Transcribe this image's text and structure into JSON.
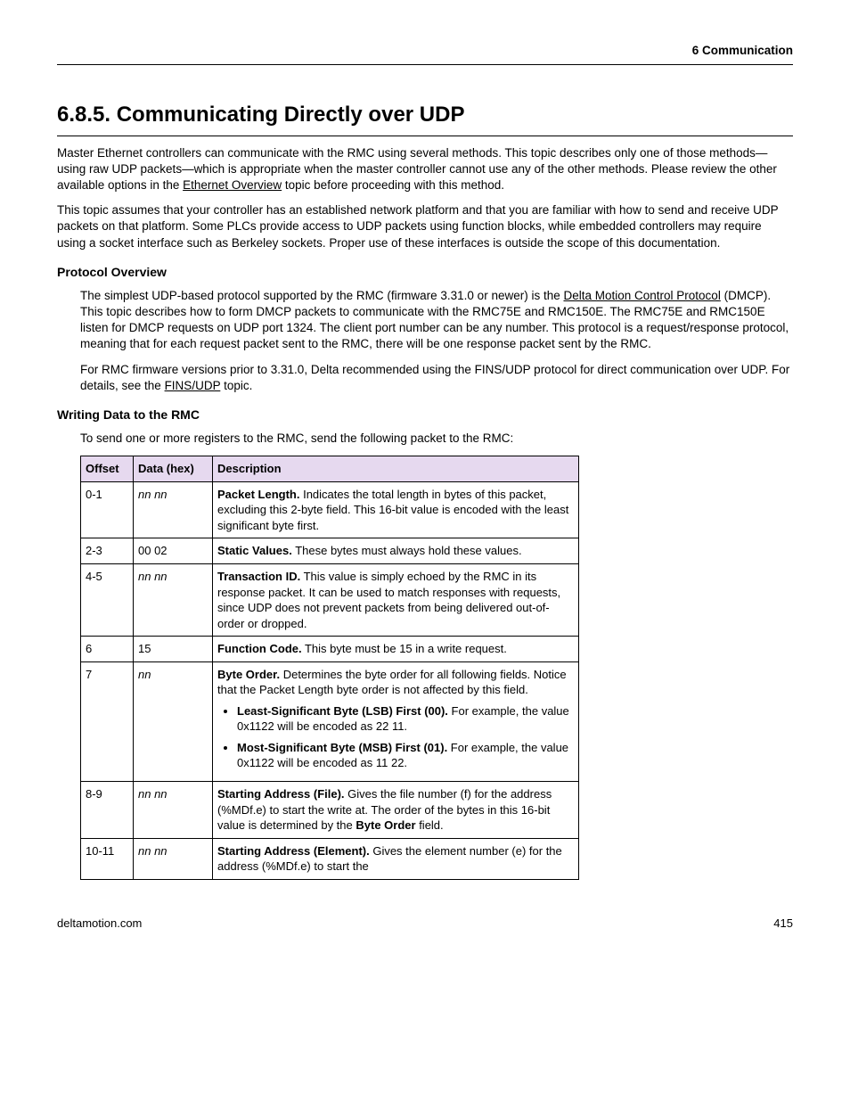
{
  "header": {
    "chapter": "6  Communication"
  },
  "title": "6.8.5. Communicating Directly over UDP",
  "intro": {
    "p1a": "Master Ethernet controllers can communicate with the RMC using several methods. This topic describes only one of those methods—using raw UDP packets—which is appropriate when the master controller cannot use any of the other methods. Please review the other available options in the ",
    "p1_link": "Ethernet Overview",
    "p1b": " topic before proceeding with this method.",
    "p2": "This topic assumes that your controller has an established network platform and that you are familiar with how to send and receive UDP packets on that platform. Some PLCs provide access to UDP packets using function blocks, while embedded controllers may require using a socket interface such as Berkeley sockets. Proper use of these interfaces is outside the scope of this documentation."
  },
  "protocol": {
    "heading": "Protocol Overview",
    "p1a": "The simplest UDP-based protocol supported by the RMC (firmware 3.31.0 or newer) is the ",
    "p1_link": "Delta Motion Control Protocol",
    "p1b": " (DMCP). This topic describes how to form DMCP packets to communicate with the RMC75E and RMC150E. The RMC75E and RMC150E listen for DMCP requests on UDP port 1324. The client port number can be any number. This protocol is a request/response protocol, meaning that for each request packet sent to the RMC, there will be one response packet sent by the RMC.",
    "p2a": "For RMC firmware versions prior to 3.31.0, Delta recommended using the FINS/UDP protocol for direct communication over UDP. For details, see the ",
    "p2_link": "FINS/UDP",
    "p2b": " topic."
  },
  "writing": {
    "heading": "Writing Data to the RMC",
    "intro": "To send one or more registers to the RMC, send the following packet to the RMC:"
  },
  "table": {
    "head": {
      "offset": "Offset",
      "data": "Data (hex)",
      "desc": "Description"
    },
    "rows": [
      {
        "offset": "0-1",
        "data": "nn nn",
        "italic": true,
        "label": "Packet Length.",
        "text": " Indicates the total length in bytes of this packet, excluding this 2-byte field. This 16-bit value is encoded with the least significant byte first."
      },
      {
        "offset": "2-3",
        "data": "00 02",
        "italic": false,
        "label": "Static Values.",
        "text": " These bytes must always hold these values."
      },
      {
        "offset": "4-5",
        "data": "nn nn",
        "italic": true,
        "label": "Transaction ID.",
        "text": " This value is simply echoed by the RMC in its response packet. It can be used to match responses with requests, since UDP does not prevent packets from being delivered out-of-order or dropped."
      },
      {
        "offset": "6",
        "data": "15",
        "italic": false,
        "label": "Function Code.",
        "text": " This byte must be 15 in a write request."
      },
      {
        "offset": "7",
        "data": "nn",
        "italic": true,
        "label": "Byte Order.",
        "text": " Determines the byte order for all following fields. Notice that the Packet Length byte order is not affected by this field.",
        "bullets": [
          {
            "label": "Least-Significant Byte (LSB) First (00).",
            "text": " For example, the value 0x1122 will be encoded as 22 11."
          },
          {
            "label": "Most-Significant Byte (MSB) First (01).",
            "text": " For example, the value 0x1122 will be encoded as 11 22."
          }
        ]
      },
      {
        "offset": "8-9",
        "data": "nn nn",
        "italic": true,
        "label": "Starting Address (File).",
        "text_a": " Gives the file number (f) for the address (%MDf.e) to start the write at. The order of the bytes in this 16-bit value is determined by the ",
        "text_bold": "Byte Order",
        "text_b": " field."
      },
      {
        "offset": "10-11",
        "data": "nn nn",
        "italic": true,
        "label": "Starting Address (Element).",
        "text": " Gives the element number (e) for the address (%MDf.e) to start the"
      }
    ]
  },
  "footer": {
    "site": "deltamotion.com",
    "page": "415"
  }
}
